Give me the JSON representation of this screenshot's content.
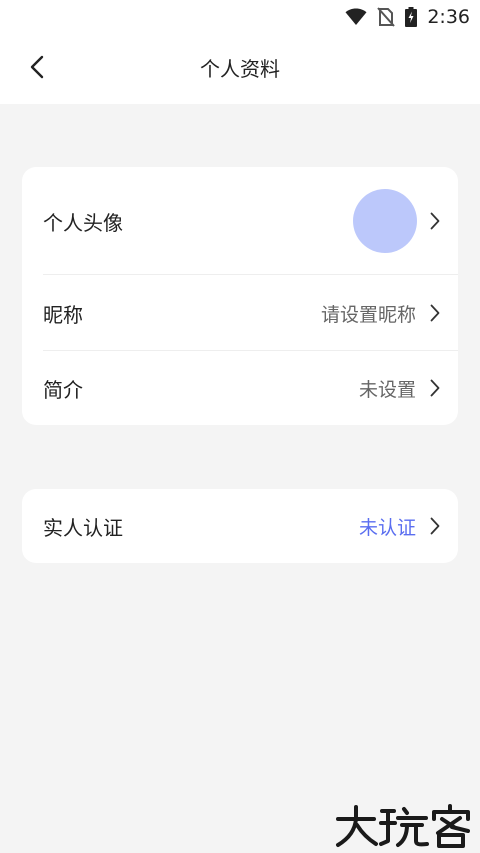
{
  "status_bar": {
    "time": "2:36",
    "icons": [
      "wifi-icon",
      "no-sim-icon",
      "battery-charging-icon"
    ]
  },
  "nav": {
    "title": "个人资料",
    "back_icon": "chevron-left-icon"
  },
  "profile": {
    "avatar_label": "个人头像",
    "avatar_color": "#bcc8fb",
    "nickname_label": "昵称",
    "nickname_value": "请设置昵称",
    "bio_label": "简介",
    "bio_value": "未设置"
  },
  "verification": {
    "label": "实人认证",
    "value": "未认证",
    "value_color": "#5a6ef0"
  },
  "watermark": {
    "text": "大玩客"
  }
}
